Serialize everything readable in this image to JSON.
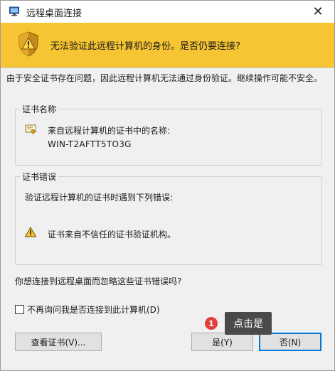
{
  "window": {
    "title": "远程桌面连接",
    "close_glyph": "✕"
  },
  "banner": {
    "text": "无法验证此远程计算机的身份。是否仍要连接?",
    "color": "#f7c533"
  },
  "description": "由于安全证书存在问题，因此远程计算机无法通过身份验证。继续操作可能不安全。",
  "cert_name_group": {
    "title": "证书名称",
    "label": "来自远程计算机的证书中的名称:",
    "value": "WIN-T2AFTT5TO3G"
  },
  "cert_error_group": {
    "title": "证书错误",
    "label": "验证远程计算机的证书时遇到下列错误:",
    "item": "证书来自不信任的证书验证机构。"
  },
  "question": "你想连接到远程桌面而忽略这些证书错误吗?",
  "checkbox": {
    "label": "不再询问我是否连接到此计算机(D)",
    "checked": false
  },
  "buttons": {
    "view_cert": "查看证书(V)...",
    "yes": "是(Y)",
    "no": "否(N)"
  },
  "annotation": {
    "badge": "1",
    "bubble": "点击是"
  },
  "icons": {
    "app": "remote-desktop-icon",
    "shield": "warning-shield-icon",
    "cert": "certificate-icon",
    "warning": "warning-triangle-icon"
  }
}
